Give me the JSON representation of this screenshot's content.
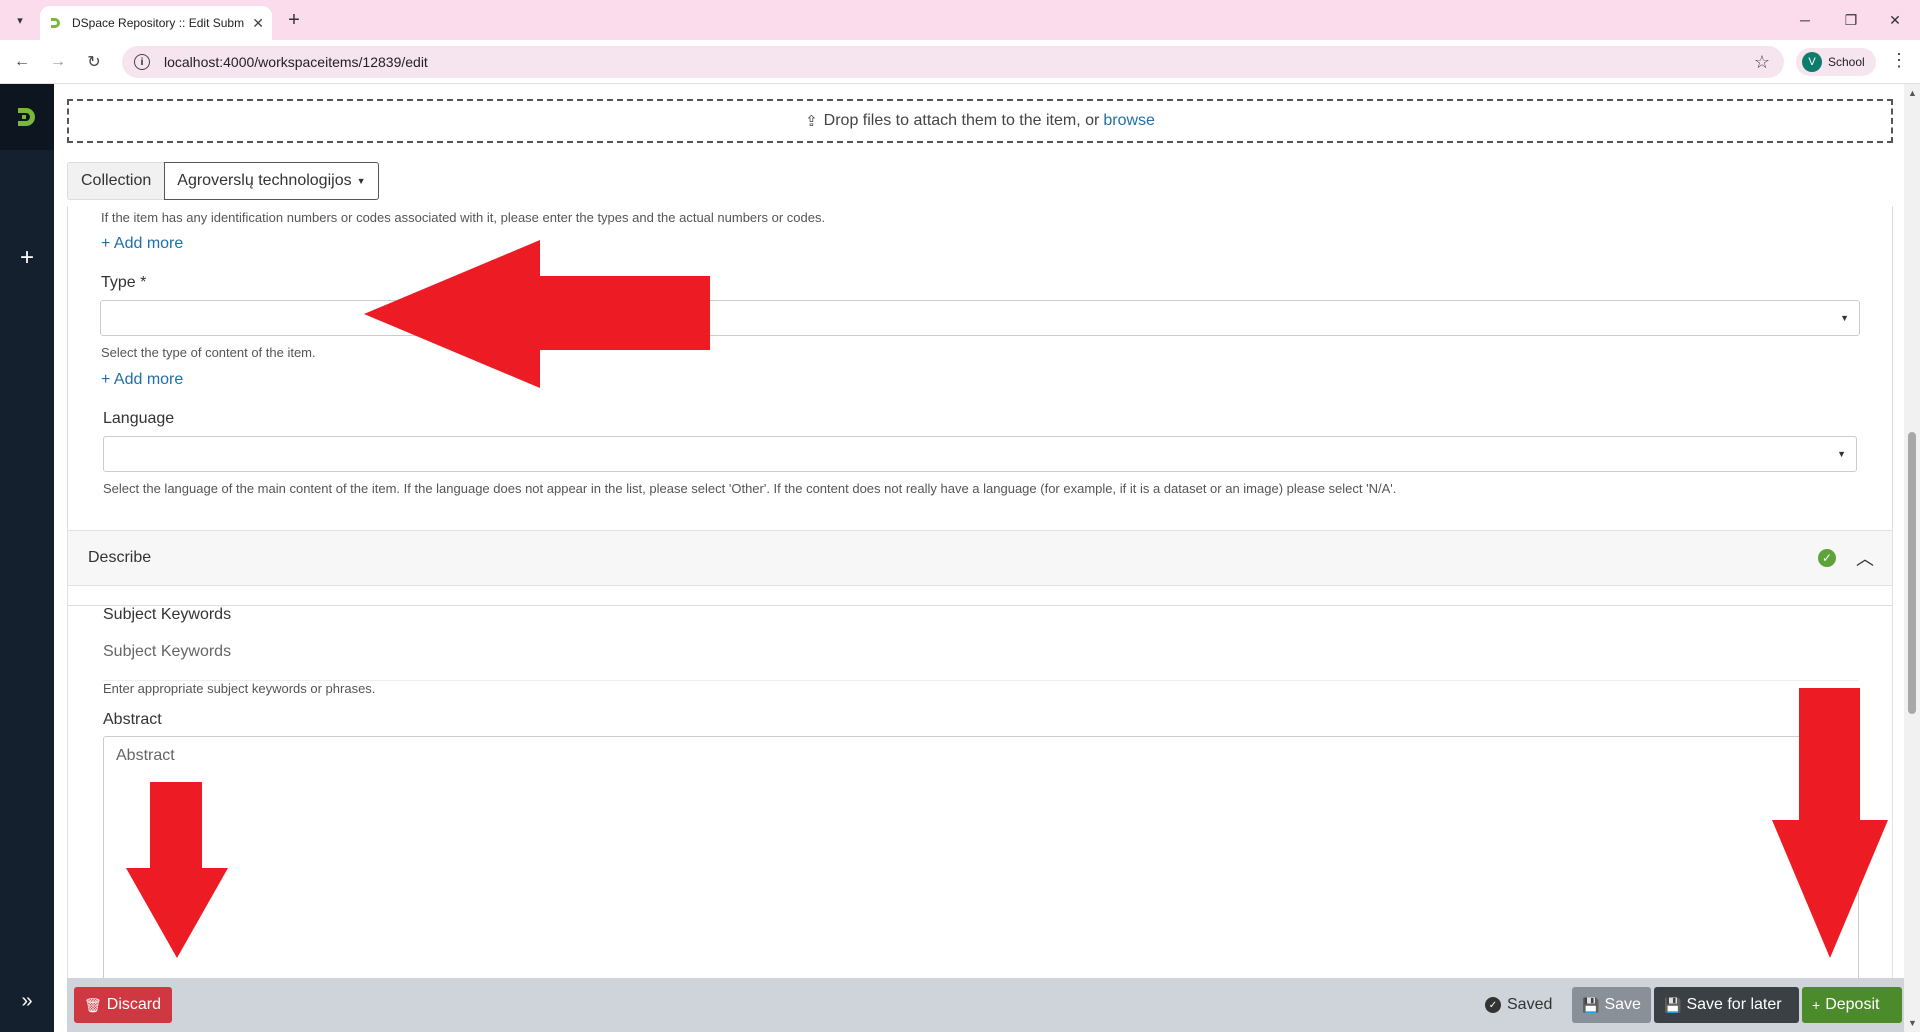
{
  "browser": {
    "tab_title": "DSpace Repository :: Edit Subm",
    "url": "localhost:4000/workspaceitems/12839/edit",
    "profile_initial": "V",
    "profile_name": "School"
  },
  "upload": {
    "text": "Drop files to attach them to the item, or",
    "link": "browse"
  },
  "collection": {
    "label": "Collection",
    "value": "Agroverslų technologijos"
  },
  "identifiers": {
    "help": "If the item has any identification numbers or codes associated with it, please enter the types and the actual numbers or codes.",
    "add_more": "Add more"
  },
  "type_field": {
    "label": "Type *",
    "value": "",
    "help": "Select the type of content of the item.",
    "add_more": "Add more"
  },
  "language_field": {
    "label": "Language",
    "value": "",
    "help": "Select the language of the main content of the item. If the language does not appear in the list, please select 'Other'. If the content does not really have a language (for example, if it is a dataset or an image) please select 'N/A'."
  },
  "describe": {
    "title": "Describe",
    "keywords_label": "Subject Keywords",
    "keywords_placeholder": "Subject Keywords",
    "keywords_help": "Enter appropriate subject keywords or phrases.",
    "abstract_label": "Abstract",
    "abstract_placeholder": "Abstract"
  },
  "footer": {
    "discard": "Discard",
    "saved": "Saved",
    "save": "Save",
    "save_for_later": "Save for later",
    "deposit": "Deposit"
  },
  "colors": {
    "annotation_arrow": "#ed1c24",
    "deposit": "#4c8b2b",
    "discard": "#cf3840"
  }
}
